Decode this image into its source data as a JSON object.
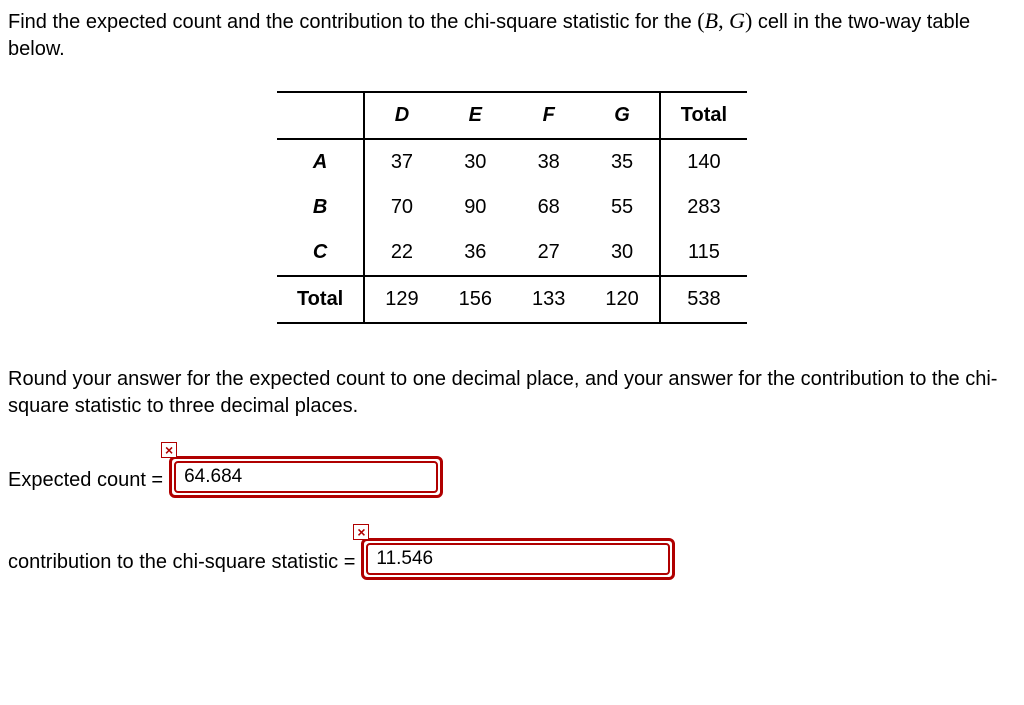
{
  "question": {
    "prefix": "Find the expected count and the contribution to the chi-square statistic for the ",
    "cell_open": "(",
    "cell_r": "B",
    "cell_sep": ", ",
    "cell_c": "G",
    "cell_close": ")",
    "suffix": " cell in the two-way table below."
  },
  "table": {
    "col_headers": [
      "D",
      "E",
      "F",
      "G"
    ],
    "total_label": "Total",
    "rows": [
      {
        "label": "A",
        "cells": [
          "37",
          "30",
          "38",
          "35"
        ],
        "total": "140"
      },
      {
        "label": "B",
        "cells": [
          "70",
          "90",
          "68",
          "55"
        ],
        "total": "283"
      },
      {
        "label": "C",
        "cells": [
          "22",
          "36",
          "27",
          "30"
        ],
        "total": "115"
      }
    ],
    "col_totals": [
      "129",
      "156",
      "133",
      "120"
    ],
    "grand_total": "538"
  },
  "instructions": "Round your answer for the expected count to one decimal place, and your answer for the contribution to the chi-square statistic to three decimal places.",
  "answers": {
    "expected_label": "Expected count =",
    "expected_value": "64.684",
    "contrib_label": "contribution to the chi-square statistic =",
    "contrib_value": "11.546"
  }
}
